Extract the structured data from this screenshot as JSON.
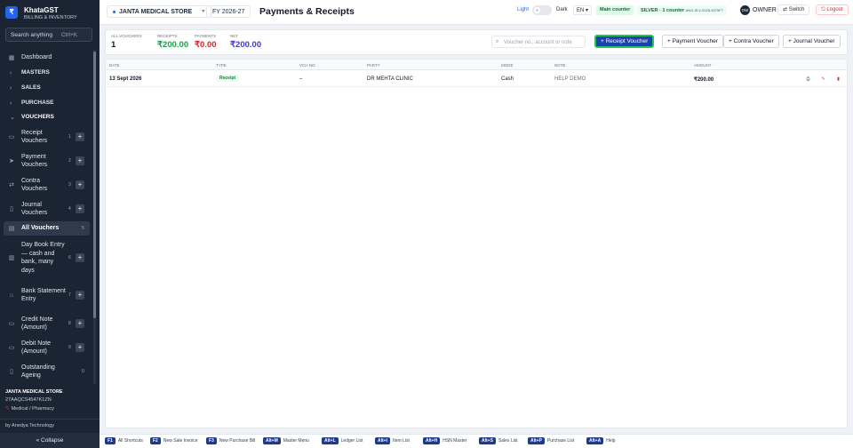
{
  "sidebar": {
    "brand_name": "KhataGST",
    "brand_tag": "BILLING & INVENTORY",
    "logo_glyph": "₹",
    "search_placeholder": "Search anything",
    "search_shortcut": "Ctrl+K",
    "items": [
      {
        "label": "Dashboard",
        "icon": "grid-icon"
      },
      {
        "label": "MASTERS",
        "icon": "chevron-right-icon"
      },
      {
        "label": "SALES",
        "icon": "chevron-right-icon"
      },
      {
        "label": "PURCHASE",
        "icon": "chevron-right-icon"
      },
      {
        "label": "VOUCHERS",
        "icon": "chevron-down-icon"
      },
      {
        "label": "Receipt Vouchers",
        "num": "1"
      },
      {
        "label": "Payment Vouchers",
        "num": "2"
      },
      {
        "label": "Contra Vouchers",
        "num": "3"
      },
      {
        "label": "Journal Vouchers",
        "num": "4"
      },
      {
        "label": "All Vouchers",
        "num": "5"
      },
      {
        "label": "Day Book Entry — cash and bank, many days",
        "num": "6"
      },
      {
        "label": "Bank Statement Entry",
        "num": "7"
      },
      {
        "label": "Credit Note (Amount)",
        "num": "8"
      },
      {
        "label": "Debit Note (Amount)",
        "num": "9"
      },
      {
        "label": "Outstanding Ageing",
        "num": "0"
      }
    ],
    "store_name": "JANTA MEDICAL STORE",
    "store_gstin": "27AAQCS4547K1ZN",
    "store_type": "Medical / Pharmacy",
    "byline": "by Anedya Technology",
    "collapse_label": "« Collapse"
  },
  "header": {
    "store": "JANTA MEDICAL STORE",
    "fy": "FY 2026-27",
    "title": "Payments & Receipts",
    "theme_light": "Light",
    "theme_dark": "Dark",
    "lang": "EN",
    "counter": "Main counter",
    "license": "SILVER · 1 counter",
    "license_code": "ANO-SLV-2026-4079F7",
    "avatar": "OW",
    "role": "OWNER",
    "switch_label": "⇄ Switch",
    "logout_label": "⎋ Logout"
  },
  "summary": {
    "all_label": "ALL VOUCHERS",
    "all_value": "1",
    "receipts_label": "RECEIPTS",
    "receipts_value": "₹200.00",
    "payments_label": "PAYMENTS",
    "payments_value": "₹0.00",
    "net_label": "NET",
    "net_value": "₹200.00",
    "search_placeholder": "Voucher no., account or note",
    "btn_receipt": "+ Receipt Voucher",
    "btn_payment": "+ Payment Voucher",
    "btn_contra": "+ Contra Voucher",
    "btn_journal": "+ Journal Voucher"
  },
  "table": {
    "headers": [
      "DATE",
      "TYPE",
      "VCH NO.",
      "PARTY",
      "MODE",
      "NOTE",
      "AMOUNT"
    ],
    "rows": [
      {
        "date": "13 Sept 2026",
        "type": "Receipt",
        "vch": "–",
        "party": "DR MEHTA CLINIC",
        "mode": "Cash",
        "note": "HELP DEMO",
        "amount": "₹200.00"
      }
    ]
  },
  "shortcuts": [
    {
      "key": "F1",
      "label": "All Shortcuts"
    },
    {
      "key": "F2",
      "label": "New Sale Invoice"
    },
    {
      "key": "F3",
      "label": "New Purchase Bill"
    },
    {
      "key": "Alt+M",
      "label": "Master Menu"
    },
    {
      "key": "Alt+L",
      "label": "Ledger List"
    },
    {
      "key": "Alt+I",
      "label": "Item List"
    },
    {
      "key": "Alt+H",
      "label": "HSN Master"
    },
    {
      "key": "Alt+S",
      "label": "Sales List"
    },
    {
      "key": "Alt+P",
      "label": "Purchase List"
    },
    {
      "key": "Alt+A",
      "label": "Help"
    }
  ],
  "colors": {
    "sidebar_bg": "#1b2433",
    "primary": "#1e40af",
    "focus_ring": "#22c55e",
    "receipts": "#16a34a",
    "payments": "#dc2626"
  }
}
